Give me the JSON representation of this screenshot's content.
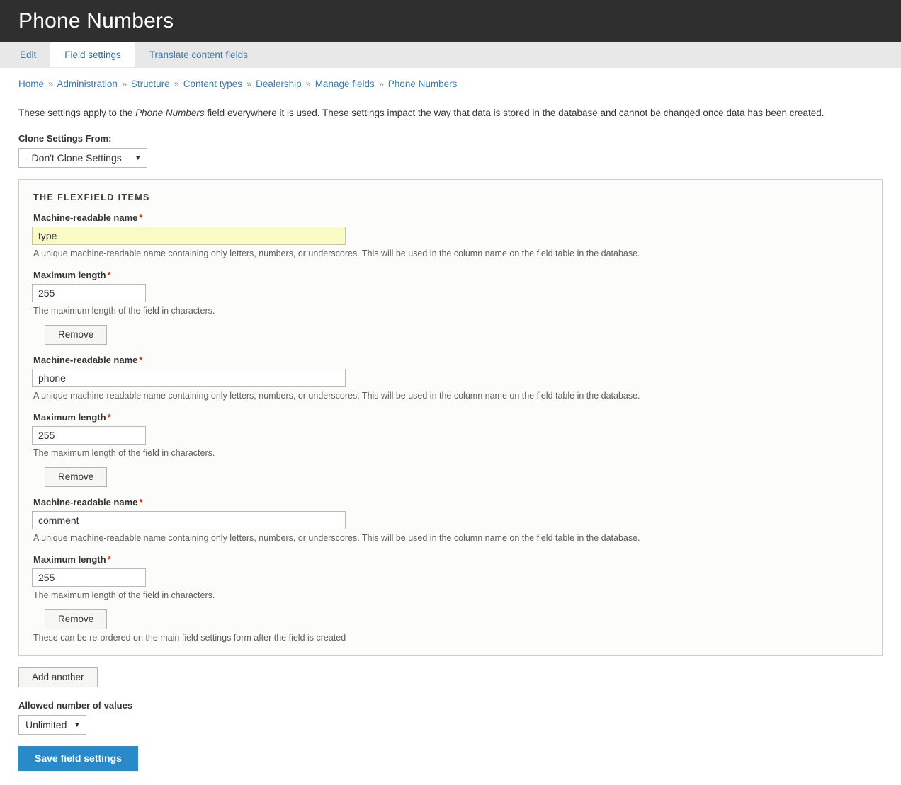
{
  "header": {
    "title": "Phone Numbers"
  },
  "tabs": [
    {
      "label": "Edit",
      "active": false
    },
    {
      "label": "Field settings",
      "active": true
    },
    {
      "label": "Translate content fields",
      "active": false
    }
  ],
  "breadcrumb": {
    "separator": "»",
    "items": [
      "Home",
      "Administration",
      "Structure",
      "Content types",
      "Dealership",
      "Manage fields",
      "Phone Numbers"
    ]
  },
  "intro": {
    "prefix": "These settings apply to the ",
    "emphasis": "Phone Numbers",
    "suffix": " field everywhere it is used. These settings impact the way that data is stored in the database and cannot be changed once data has been created."
  },
  "clone": {
    "label": "Clone Settings From:",
    "value": "- Don't Clone Settings -",
    "arrow": "chevron-down-icon"
  },
  "fieldset": {
    "legend": "THE FLEXFIELD ITEMS",
    "footer_note": "These can be re-ordered on the main field settings form after the field is created",
    "name_label": "Machine-readable name",
    "name_description": "A unique machine-readable name containing only letters, numbers, or underscores. This will be used in the column name on the field table in the database.",
    "length_label": "Maximum length",
    "length_description": "The maximum length of the field in characters.",
    "required_marker": "*",
    "remove_label": "Remove",
    "items": [
      {
        "name": "type",
        "length": "255",
        "autofilled": true
      },
      {
        "name": "phone",
        "length": "255",
        "autofilled": false
      },
      {
        "name": "comment",
        "length": "255",
        "autofilled": false
      }
    ]
  },
  "add_another": {
    "label": "Add another"
  },
  "cardinality": {
    "label": "Allowed number of values",
    "value": "Unlimited",
    "arrow": "chevron-down-icon"
  },
  "save": {
    "label": "Save field settings"
  },
  "colors": {
    "header_bg": "#2f2f2f",
    "tab_bg": "#e8e8e8",
    "link": "#3c7ca8",
    "primary": "#2a8ac9",
    "required": "#e32700",
    "autofill": "#fbfbc8",
    "fieldset_bg": "#fcfcfa",
    "fieldset_border": "#cfcfc9"
  }
}
